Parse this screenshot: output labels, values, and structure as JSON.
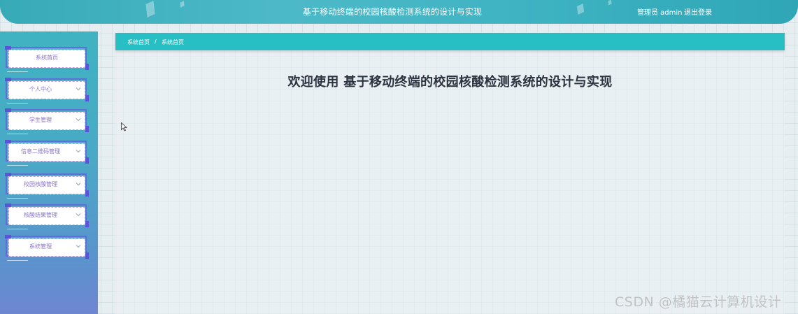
{
  "header": {
    "title": "基于移动终端的校园核酸检测系统的设计与实现",
    "user_text": "管理员 admin",
    "logout_label": "退出登录"
  },
  "sidebar": {
    "items": [
      {
        "label": "系统首页",
        "has_chevron": false
      },
      {
        "label": "个人中心",
        "has_chevron": true
      },
      {
        "label": "学生管理",
        "has_chevron": true
      },
      {
        "label": "信息二维码管理",
        "has_chevron": true
      },
      {
        "label": "校园核酸管理",
        "has_chevron": true
      },
      {
        "label": "核酸结果管理",
        "has_chevron": true
      },
      {
        "label": "系统管理",
        "has_chevron": true
      }
    ]
  },
  "breadcrumb": {
    "items": [
      "系统首页",
      "系统首页"
    ],
    "separator": "/"
  },
  "main": {
    "welcome": "欢迎使用 基于移动终端的校园核酸检测系统的设计与实现"
  },
  "watermark": "CSDN @橘猫云计算机设计",
  "colors": {
    "header": "#3fb3c2",
    "breadcrumb": "#27bfc4",
    "menu_border": "#5f6fd9",
    "menu_text": "#8a72c9",
    "welcome_text": "#2e3340"
  },
  "icons": {
    "chevron": "chevron-down-icon",
    "cursor": "mouse-pointer-icon"
  }
}
